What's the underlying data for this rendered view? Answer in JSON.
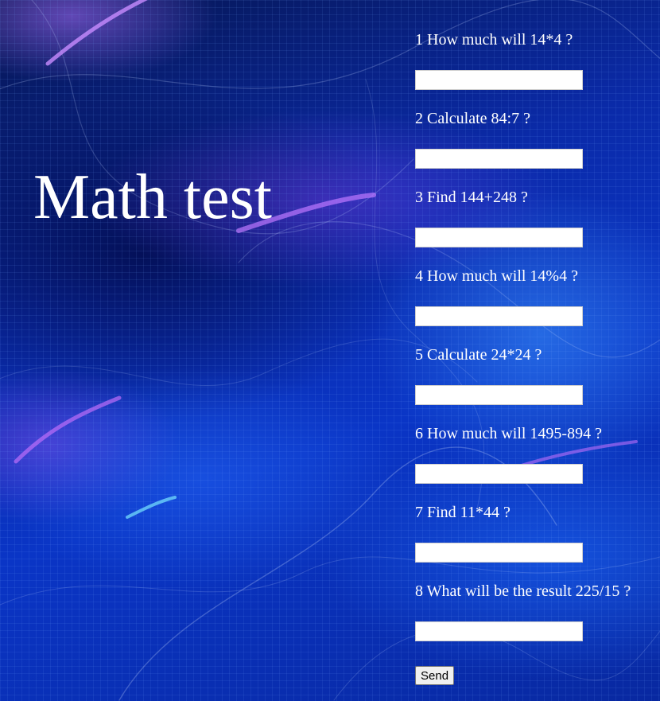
{
  "page": {
    "title": "Math test"
  },
  "questions": [
    {
      "label": "1 How much will 14*4 ?",
      "value": ""
    },
    {
      "label": "2 Calculate 84:7 ?",
      "value": ""
    },
    {
      "label": "3 Find 144+248 ?",
      "value": ""
    },
    {
      "label": "4 How much will 14%4 ?",
      "value": ""
    },
    {
      "label": "5 Calculate 24*24 ?",
      "value": ""
    },
    {
      "label": "6 How much will 1495-894 ?",
      "value": ""
    },
    {
      "label": "7 Find 11*44 ?",
      "value": ""
    },
    {
      "label": "8 What will be the result 225/15 ?",
      "value": ""
    }
  ],
  "form": {
    "submit_label": "Send"
  },
  "theme": {
    "background": "#0a2aa8",
    "text_color": "#ffffff"
  }
}
